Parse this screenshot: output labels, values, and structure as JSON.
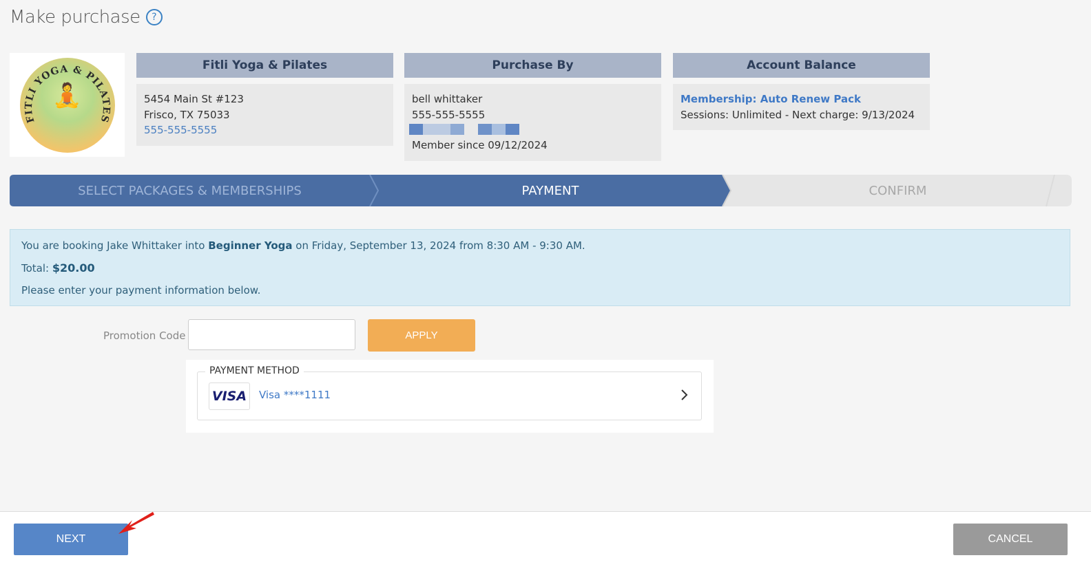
{
  "page": {
    "title": "Make purchase",
    "help_icon": "?"
  },
  "studio": {
    "header": "Fitli Yoga & Pilates",
    "address1": "5454 Main St #123",
    "address2": "Frisco, TX 75033",
    "phone": "555-555-5555",
    "logo_text": "FITLI YOGA & PILATES"
  },
  "purchaser": {
    "header": "Purchase By",
    "name": "bell whittaker",
    "phone": "555-555-5555",
    "member_since": "Member since 09/12/2024"
  },
  "balance": {
    "header": "Account Balance",
    "membership": "Membership: Auto Renew Pack",
    "details": "Sessions: Unlimited -  Next charge: 9/13/2024"
  },
  "steps": [
    {
      "label": "SELECT PACKAGES & MEMBERSHIPS",
      "state": "done"
    },
    {
      "label": "PAYMENT",
      "state": "active"
    },
    {
      "label": "CONFIRM",
      "state": "pending"
    }
  ],
  "booking": {
    "prefix": "You are booking Jake Whittaker into ",
    "class_name": "Beginner Yoga",
    "suffix": " on Friday, September 13, 2024 from 8:30 AM - 9:30 AM.",
    "total_label": "Total: ",
    "total_value": "$20.00",
    "instruction": "Please enter your payment information below."
  },
  "promo": {
    "label": "Promotion Code",
    "value": "",
    "apply_label": "APPLY"
  },
  "payment": {
    "legend": "PAYMENT METHOD",
    "card_brand": "VISA",
    "card_text": "Visa ****1111"
  },
  "footer": {
    "next_label": "NEXT",
    "cancel_label": "CANCEL"
  },
  "colors": {
    "primary": "#4a6da3",
    "accent": "#f2ad55",
    "info_bg": "#d9ecf5"
  }
}
